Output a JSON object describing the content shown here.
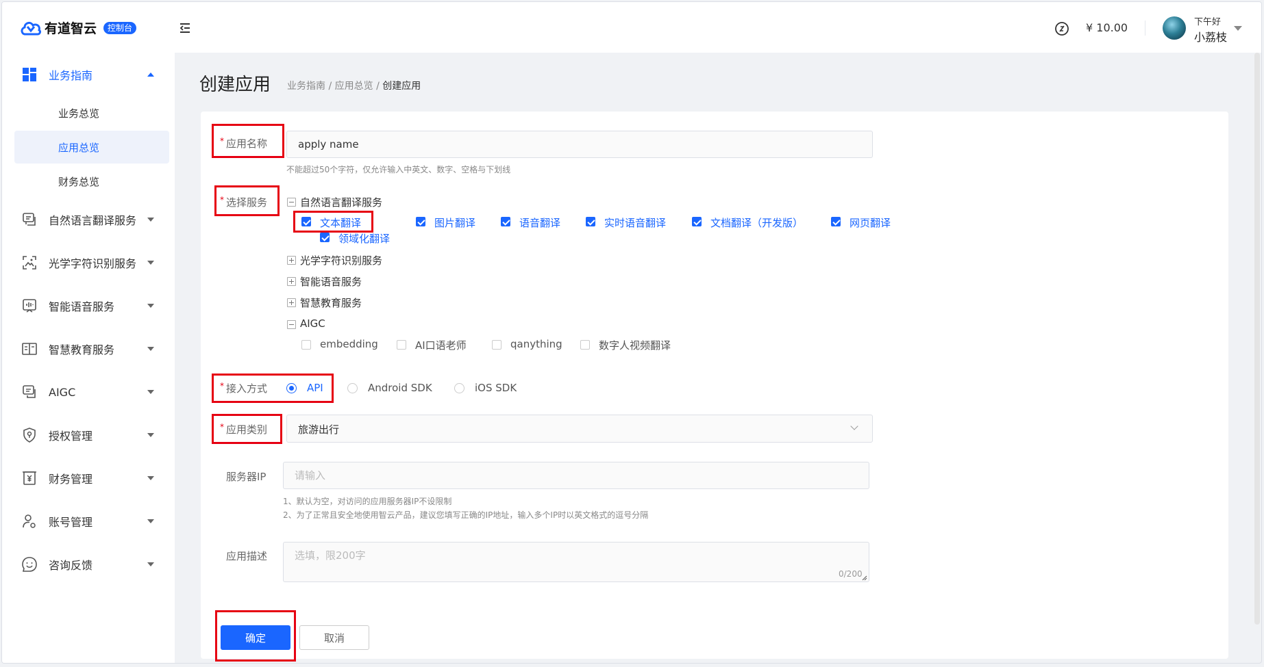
{
  "header": {
    "logo_text": "有道智云",
    "logo_badge": "控制台",
    "balance": "¥ 10.00",
    "greeting": "下午好",
    "username": "小荔枝"
  },
  "sidebar": {
    "items": [
      {
        "label": "业务指南",
        "icon": "grid-icon",
        "open": true,
        "children": [
          {
            "label": "业务总览"
          },
          {
            "label": "应用总览",
            "active": true
          },
          {
            "label": "财务总览"
          }
        ]
      },
      {
        "label": "自然语言翻译服务",
        "icon": "chat-translate-icon"
      },
      {
        "label": "光学字符识别服务",
        "icon": "scan-image-icon"
      },
      {
        "label": "智能语音服务",
        "icon": "voice-wave-icon"
      },
      {
        "label": "智慧教育服务",
        "icon": "book-icon"
      },
      {
        "label": "AIGC",
        "icon": "chat-bubbles-icon"
      },
      {
        "label": "授权管理",
        "icon": "shield-key-icon"
      },
      {
        "label": "财务管理",
        "icon": "yuan-doc-icon"
      },
      {
        "label": "账号管理",
        "icon": "user-gear-icon"
      },
      {
        "label": "咨询反馈",
        "icon": "smile-icon"
      }
    ]
  },
  "page": {
    "title": "创建应用",
    "breadcrumb": [
      "业务指南",
      "应用总览",
      "创建应用"
    ],
    "breadcrumb_sep": " / "
  },
  "form": {
    "app_name": {
      "label": "应用名称",
      "value": "apply name",
      "hint": "不能超过50个字符，仅允许输入中英文、数字、空格与下划线"
    },
    "services": {
      "label": "选择服务",
      "groups": [
        {
          "name": "自然语言翻译服务",
          "expanded": true
        },
        {
          "name": "光学字符识别服务",
          "expanded": false
        },
        {
          "name": "智能语音服务",
          "expanded": false
        },
        {
          "name": "智慧教育服务",
          "expanded": false
        },
        {
          "name": "AIGC",
          "expanded": true
        }
      ],
      "nlp_options": [
        {
          "label": "文本翻译",
          "checked": true
        },
        {
          "label": "图片翻译",
          "checked": true
        },
        {
          "label": "语音翻译",
          "checked": true
        },
        {
          "label": "实时语音翻译",
          "checked": true
        },
        {
          "label": "文档翻译（开发版）",
          "checked": true
        },
        {
          "label": "网页翻译",
          "checked": true
        }
      ],
      "nlp_sub_option": {
        "label": "领域化翻译",
        "checked": true
      },
      "aigc_options": [
        {
          "label": "embedding",
          "checked": false
        },
        {
          "label": "AI口语老师",
          "checked": false
        },
        {
          "label": "qanything",
          "checked": false
        },
        {
          "label": "数字人视频翻译",
          "checked": false
        }
      ]
    },
    "access": {
      "label": "接入方式",
      "options": [
        {
          "label": "API",
          "selected": true
        },
        {
          "label": "Android SDK",
          "selected": false
        },
        {
          "label": "iOS SDK",
          "selected": false
        }
      ]
    },
    "category": {
      "label": "应用类别",
      "value": "旅游出行"
    },
    "server_ip": {
      "label": "服务器IP",
      "placeholder": "请输入",
      "hints": [
        "1、默认为空，对访问的应用服务器IP不设限制",
        "2、为了正常且安全地使用智云产品，建议您填写正确的IP地址，输入多个IP时以英文格式的逗号分隔"
      ]
    },
    "description": {
      "label": "应用描述",
      "placeholder": "选填，限200字",
      "counter": "0/200"
    },
    "buttons": {
      "confirm": "确定",
      "cancel": "取消"
    }
  },
  "colors": {
    "accent": "#1a66ff",
    "highlight": "#e60012"
  }
}
